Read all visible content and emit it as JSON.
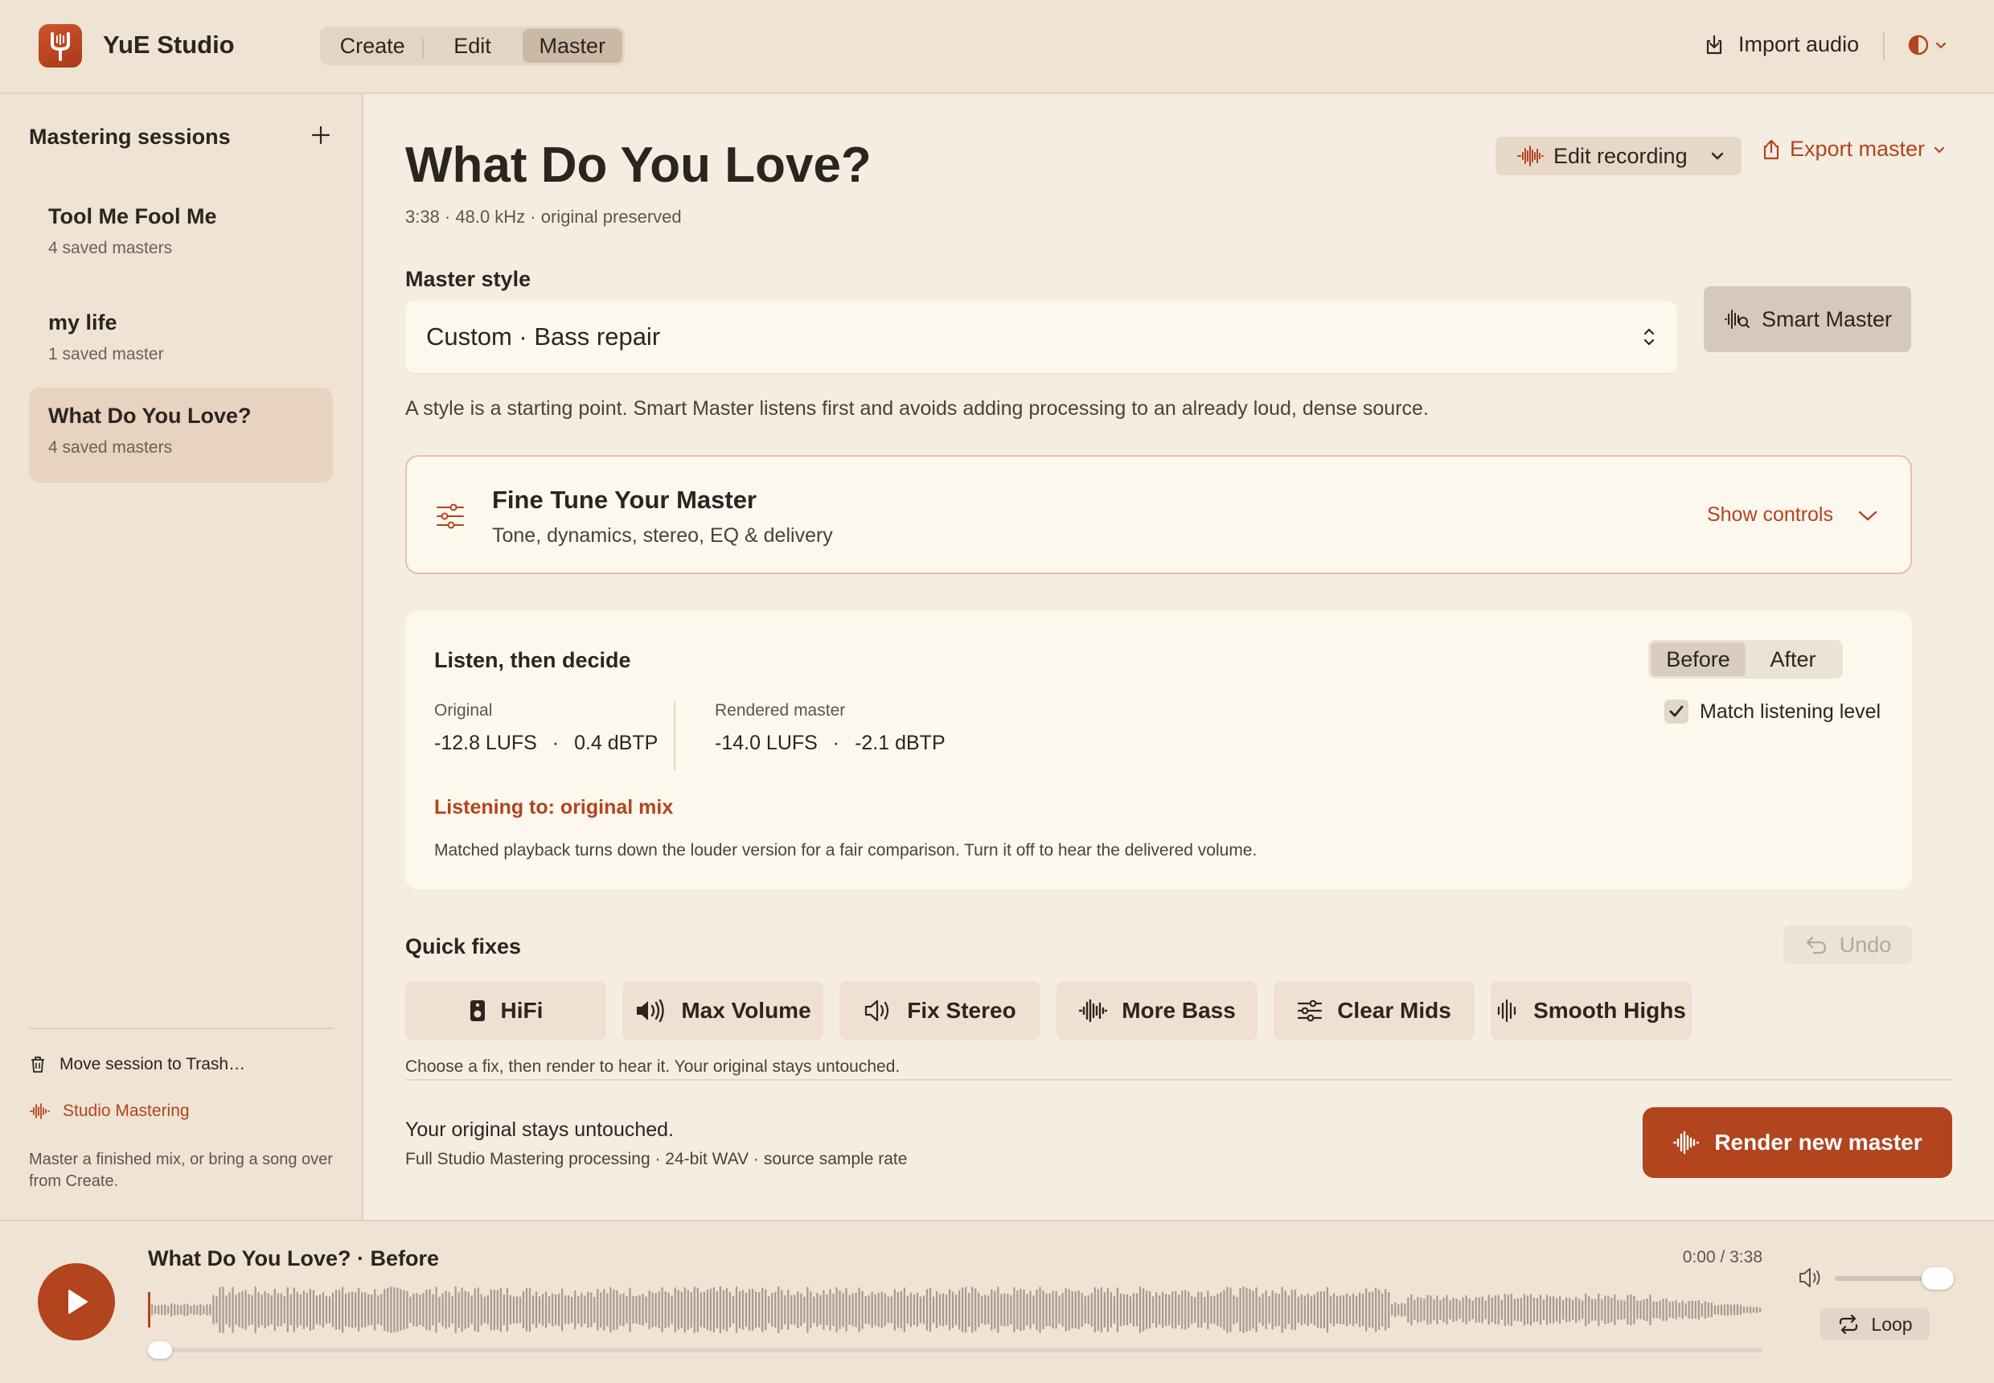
{
  "app": {
    "title": "YuE Studio",
    "modes": [
      "Create",
      "Edit",
      "Master"
    ],
    "active_mode": "Master",
    "import_label": "Import audio",
    "accent_color": "#b2441e"
  },
  "sidebar": {
    "heading": "Mastering sessions",
    "sessions": [
      {
        "name": "Tool Me Fool Me",
        "meta": "4 saved masters"
      },
      {
        "name": "my life",
        "meta": "1 saved master"
      },
      {
        "name": "What Do You Love?",
        "meta": "4 saved masters"
      }
    ],
    "active_session": "What Do You Love?",
    "trash_label": "Move session to Trash…",
    "studio_label": "Studio Mastering",
    "help_text": "Master a finished mix, or bring a song over from Create."
  },
  "main": {
    "title": "What Do You Love?",
    "meta": "3:38 · 48.0 kHz · original preserved",
    "edit_recording_label": "Edit recording",
    "export_label": "Export master",
    "master_style_label": "Master style",
    "master_style_value": "Custom · Bass repair",
    "smart_master_label": "Smart Master",
    "style_help": "A style is a starting point. Smart Master listens first and avoids adding processing to an already loud, dense source."
  },
  "fine_tune": {
    "title": "Fine Tune Your Master",
    "subtitle": "Tone, dynamics, stereo, EQ & delivery",
    "toggle_label": "Show controls"
  },
  "listen": {
    "title": "Listen, then decide",
    "toggle": [
      "Before",
      "After"
    ],
    "active_toggle": "Before",
    "match_label": "Match listening level",
    "match_checked": true,
    "original_label": "Original",
    "original_lufs": "-12.8 LUFS",
    "original_dbtp": "0.4 dBTP",
    "rendered_label": "Rendered master",
    "rendered_lufs": "-14.0 LUFS",
    "rendered_dbtp": "-2.1 dBTP",
    "sep": "·",
    "listening_to": "Listening to: original mix",
    "help": "Matched playback turns down the louder version for a fair comparison. Turn it off to hear the delivered volume."
  },
  "quick_fixes": {
    "title": "Quick fixes",
    "undo_label": "Undo",
    "items": [
      {
        "label": "HiFi",
        "icon": "speaker-icon"
      },
      {
        "label": "Max Volume",
        "icon": "volume-icon"
      },
      {
        "label": "Fix Stereo",
        "icon": "stereo-icon"
      },
      {
        "label": "More Bass",
        "icon": "waveform-icon"
      },
      {
        "label": "Clear Mids",
        "icon": "sliders-icon"
      },
      {
        "label": "Smooth Highs",
        "icon": "bars-icon"
      }
    ],
    "help": "Choose a fix, then render to hear it. Your original stays untouched."
  },
  "render": {
    "note": "Your original stays untouched.",
    "sub": "Full Studio Mastering processing · 24-bit WAV · source sample rate",
    "button_label": "Render new master"
  },
  "player": {
    "track_title": "What Do You Love? · Before",
    "time": "0:00 / 3:38",
    "progress": 0.0,
    "volume": 0.85,
    "loop_label": "Loop"
  }
}
